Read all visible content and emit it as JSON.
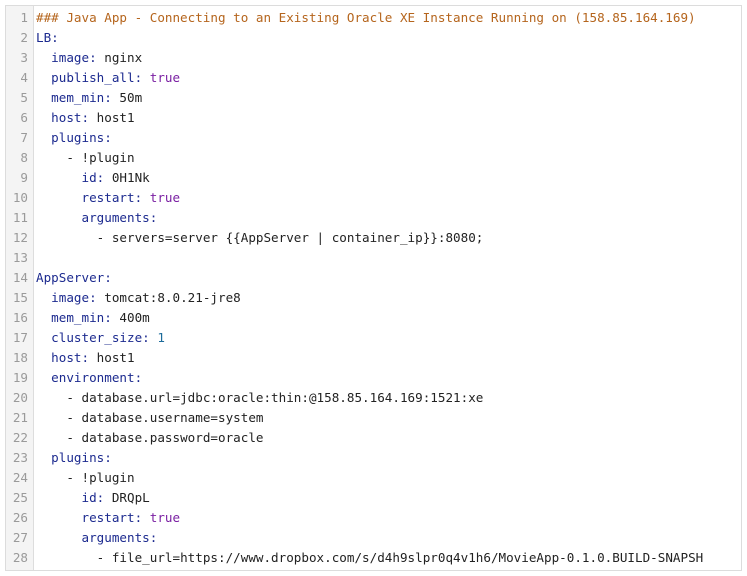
{
  "colors": {
    "comment": "#b5651d",
    "key": "#1c2a8f",
    "keyword": "#7a1fa2",
    "number": "#1c6b9a",
    "text": "#222222",
    "line_number": "#9a9a9a",
    "gutter_bg": "#f4f4f4",
    "border": "#dcdcdc"
  },
  "editor": {
    "lines": [
      {
        "num": "1",
        "indent": "",
        "tokens": [
          {
            "t": "comment",
            "v": "### Java App - Connecting to an Existing Oracle XE Instance Running on (158.85.164.169)"
          }
        ]
      },
      {
        "num": "2",
        "indent": "",
        "tokens": [
          {
            "t": "key",
            "v": "LB:"
          }
        ]
      },
      {
        "num": "3",
        "indent": "  ",
        "tokens": [
          {
            "t": "key",
            "v": "image:"
          },
          {
            "t": "val",
            "v": " nginx"
          }
        ]
      },
      {
        "num": "4",
        "indent": "  ",
        "tokens": [
          {
            "t": "key",
            "v": "publish_all:"
          },
          {
            "t": "kw",
            "v": " true"
          }
        ]
      },
      {
        "num": "5",
        "indent": "  ",
        "tokens": [
          {
            "t": "key",
            "v": "mem_min:"
          },
          {
            "t": "val",
            "v": " 50m"
          }
        ]
      },
      {
        "num": "6",
        "indent": "  ",
        "tokens": [
          {
            "t": "key",
            "v": "host:"
          },
          {
            "t": "val",
            "v": " host1"
          }
        ]
      },
      {
        "num": "7",
        "indent": "  ",
        "tokens": [
          {
            "t": "key",
            "v": "plugins:"
          }
        ]
      },
      {
        "num": "8",
        "indent": "    ",
        "tokens": [
          {
            "t": "text",
            "v": "- !plugin"
          }
        ]
      },
      {
        "num": "9",
        "indent": "      ",
        "tokens": [
          {
            "t": "key",
            "v": "id:"
          },
          {
            "t": "val",
            "v": " 0H1Nk"
          }
        ]
      },
      {
        "num": "10",
        "indent": "      ",
        "tokens": [
          {
            "t": "key",
            "v": "restart:"
          },
          {
            "t": "kw",
            "v": " true"
          }
        ]
      },
      {
        "num": "11",
        "indent": "      ",
        "tokens": [
          {
            "t": "key",
            "v": "arguments:"
          }
        ]
      },
      {
        "num": "12",
        "indent": "        ",
        "tokens": [
          {
            "t": "text",
            "v": "- servers=server {{AppServer | container_ip}}:8080;"
          }
        ]
      },
      {
        "num": "13",
        "indent": "",
        "tokens": []
      },
      {
        "num": "14",
        "indent": "",
        "tokens": [
          {
            "t": "key",
            "v": "AppServer:"
          }
        ]
      },
      {
        "num": "15",
        "indent": "  ",
        "tokens": [
          {
            "t": "key",
            "v": "image:"
          },
          {
            "t": "val",
            "v": " tomcat:8.0.21-jre8"
          }
        ]
      },
      {
        "num": "16",
        "indent": "  ",
        "tokens": [
          {
            "t": "key",
            "v": "mem_min:"
          },
          {
            "t": "val",
            "v": " 400m"
          }
        ]
      },
      {
        "num": "17",
        "indent": "  ",
        "tokens": [
          {
            "t": "key",
            "v": "cluster_size:"
          },
          {
            "t": "num",
            "v": " 1"
          }
        ]
      },
      {
        "num": "18",
        "indent": "  ",
        "tokens": [
          {
            "t": "key",
            "v": "host:"
          },
          {
            "t": "val",
            "v": " host1"
          }
        ]
      },
      {
        "num": "19",
        "indent": "  ",
        "tokens": [
          {
            "t": "key",
            "v": "environment:"
          }
        ]
      },
      {
        "num": "20",
        "indent": "    ",
        "tokens": [
          {
            "t": "text",
            "v": "- database.url=jdbc:oracle:thin:@158.85.164.169:1521:xe"
          }
        ]
      },
      {
        "num": "21",
        "indent": "    ",
        "tokens": [
          {
            "t": "text",
            "v": "- database.username=system"
          }
        ]
      },
      {
        "num": "22",
        "indent": "    ",
        "tokens": [
          {
            "t": "text",
            "v": "- database.password=oracle"
          }
        ]
      },
      {
        "num": "23",
        "indent": "  ",
        "tokens": [
          {
            "t": "key",
            "v": "plugins:"
          }
        ]
      },
      {
        "num": "24",
        "indent": "    ",
        "tokens": [
          {
            "t": "text",
            "v": "- !plugin"
          }
        ]
      },
      {
        "num": "25",
        "indent": "      ",
        "tokens": [
          {
            "t": "key",
            "v": "id:"
          },
          {
            "t": "val",
            "v": " DRQpL"
          }
        ]
      },
      {
        "num": "26",
        "indent": "      ",
        "tokens": [
          {
            "t": "key",
            "v": "restart:"
          },
          {
            "t": "kw",
            "v": " true"
          }
        ]
      },
      {
        "num": "27",
        "indent": "      ",
        "tokens": [
          {
            "t": "key",
            "v": "arguments:"
          }
        ]
      },
      {
        "num": "28",
        "indent": "        ",
        "tokens": [
          {
            "t": "text",
            "v": "- file_url=https://www.dropbox.com/s/d4h9slpr0q4v1h6/MovieApp-0.1.0.BUILD-SNAPSH"
          }
        ]
      }
    ]
  }
}
